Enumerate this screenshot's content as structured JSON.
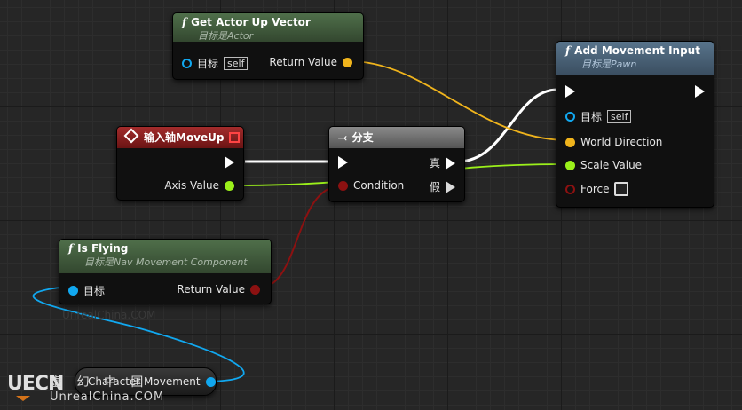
{
  "colors": {
    "exec": "#ffffff",
    "object": "#11a8f0",
    "float": "#9bf01a",
    "vector": "#f0b41c",
    "bool": "#8c1111",
    "struct_border": "#7a0f0f"
  },
  "nodes": {
    "get_actor_up": {
      "title": "Get Actor Up Vector",
      "target_prefix": "目标是",
      "target_class": "Actor",
      "pin_target": "目标",
      "self_label": "self",
      "pin_return": "Return Value"
    },
    "add_movement": {
      "title": "Add Movement Input",
      "target_prefix": "目标是",
      "target_class": "Pawn",
      "pin_target": "目标",
      "self_label": "self",
      "pin_world_dir": "World Direction",
      "pin_scale": "Scale Value",
      "pin_force": "Force"
    },
    "input_axis": {
      "title": "输入轴MoveUp",
      "pin_axis": "Axis Value"
    },
    "branch": {
      "title": "分支",
      "pin_condition": "Condition",
      "pin_true": "真",
      "pin_false": "假"
    },
    "is_flying": {
      "title": "Is Flying",
      "target_prefix": "目标是",
      "target_class": "Nav Movement Component",
      "pin_target": "目标",
      "pin_return": "Return Value"
    },
    "char_movement": {
      "label": "Character Movement"
    }
  },
  "watermark": {
    "logo": "UECN",
    "cn": "虚 幻 中 国",
    "url": "UnrealChina.COM",
    "faint": "UnrealChina.COM"
  }
}
